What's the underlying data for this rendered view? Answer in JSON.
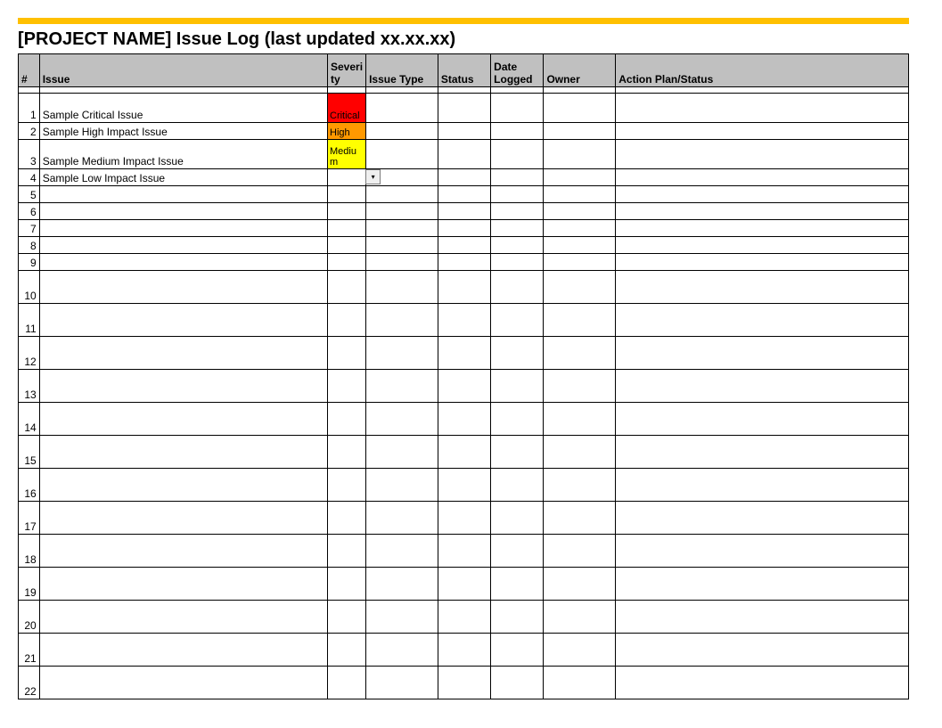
{
  "colors": {
    "accent_bar": "#ffc000",
    "header_bg": "#c0c0c0",
    "severity": {
      "critical": "#ff0000",
      "high": "#ff9900",
      "medium": "#ffff00",
      "default": "#ffffff"
    }
  },
  "title": "[PROJECT NAME] Issue Log (last updated xx.xx.xx)",
  "headers": {
    "num": "#",
    "issue": "Issue",
    "severity": "Severity",
    "issue_type": "Issue Type",
    "status": "Status",
    "date_logged": "Date Logged",
    "owner": "Owner",
    "action_plan": "Action Plan/Status"
  },
  "rows": [
    {
      "num": "1",
      "issue": "Sample Critical Issue",
      "severity": "Critical",
      "severity_key": "critical",
      "height": "med",
      "issue_type": "",
      "status": "",
      "date_logged": "",
      "owner": "",
      "action_plan": "",
      "active_dropdown": false
    },
    {
      "num": "2",
      "issue": "Sample High Impact Issue",
      "severity": "High",
      "severity_key": "high",
      "height": "short",
      "issue_type": "",
      "status": "",
      "date_logged": "",
      "owner": "",
      "action_plan": "",
      "active_dropdown": false
    },
    {
      "num": "3",
      "issue": "Sample Medium Impact Issue",
      "severity": "Medium",
      "severity_key": "medium",
      "height": "med",
      "issue_type": "",
      "status": "",
      "date_logged": "",
      "owner": "",
      "action_plan": "",
      "active_dropdown": false
    },
    {
      "num": "4",
      "issue": "Sample Low Impact Issue",
      "severity": "",
      "severity_key": "default",
      "height": "short",
      "issue_type": "",
      "status": "",
      "date_logged": "",
      "owner": "",
      "action_plan": "",
      "active_dropdown": true
    },
    {
      "num": "5",
      "issue": "",
      "severity": "",
      "severity_key": "default",
      "height": "short",
      "issue_type": "",
      "status": "",
      "date_logged": "",
      "owner": "",
      "action_plan": "",
      "active_dropdown": false
    },
    {
      "num": "6",
      "issue": "",
      "severity": "",
      "severity_key": "default",
      "height": "short",
      "issue_type": "",
      "status": "",
      "date_logged": "",
      "owner": "",
      "action_plan": "",
      "active_dropdown": false
    },
    {
      "num": "7",
      "issue": "",
      "severity": "",
      "severity_key": "default",
      "height": "short",
      "issue_type": "",
      "status": "",
      "date_logged": "",
      "owner": "",
      "action_plan": "",
      "active_dropdown": false
    },
    {
      "num": "8",
      "issue": "",
      "severity": "",
      "severity_key": "default",
      "height": "short",
      "issue_type": "",
      "status": "",
      "date_logged": "",
      "owner": "",
      "action_plan": "",
      "active_dropdown": false
    },
    {
      "num": "9",
      "issue": "",
      "severity": "",
      "severity_key": "default",
      "height": "short",
      "issue_type": "",
      "status": "",
      "date_logged": "",
      "owner": "",
      "action_plan": "",
      "active_dropdown": false
    },
    {
      "num": "10",
      "issue": "",
      "severity": "",
      "severity_key": "default",
      "height": "tall",
      "issue_type": "",
      "status": "",
      "date_logged": "",
      "owner": "",
      "action_plan": "",
      "active_dropdown": false
    },
    {
      "num": "11",
      "issue": "",
      "severity": "",
      "severity_key": "default",
      "height": "tall",
      "issue_type": "",
      "status": "",
      "date_logged": "",
      "owner": "",
      "action_plan": "",
      "active_dropdown": false
    },
    {
      "num": "12",
      "issue": "",
      "severity": "",
      "severity_key": "default",
      "height": "tall",
      "issue_type": "",
      "status": "",
      "date_logged": "",
      "owner": "",
      "action_plan": "",
      "active_dropdown": false
    },
    {
      "num": "13",
      "issue": "",
      "severity": "",
      "severity_key": "default",
      "height": "tall",
      "issue_type": "",
      "status": "",
      "date_logged": "",
      "owner": "",
      "action_plan": "",
      "active_dropdown": false
    },
    {
      "num": "14",
      "issue": "",
      "severity": "",
      "severity_key": "default",
      "height": "tall",
      "issue_type": "",
      "status": "",
      "date_logged": "",
      "owner": "",
      "action_plan": "",
      "active_dropdown": false
    },
    {
      "num": "15",
      "issue": "",
      "severity": "",
      "severity_key": "default",
      "height": "tall",
      "issue_type": "",
      "status": "",
      "date_logged": "",
      "owner": "",
      "action_plan": "",
      "active_dropdown": false
    },
    {
      "num": "16",
      "issue": "",
      "severity": "",
      "severity_key": "default",
      "height": "tall",
      "issue_type": "",
      "status": "",
      "date_logged": "",
      "owner": "",
      "action_plan": "",
      "active_dropdown": false
    },
    {
      "num": "17",
      "issue": "",
      "severity": "",
      "severity_key": "default",
      "height": "tall",
      "issue_type": "",
      "status": "",
      "date_logged": "",
      "owner": "",
      "action_plan": "",
      "active_dropdown": false
    },
    {
      "num": "18",
      "issue": "",
      "severity": "",
      "severity_key": "default",
      "height": "tall",
      "issue_type": "",
      "status": "",
      "date_logged": "",
      "owner": "",
      "action_plan": "",
      "active_dropdown": false
    },
    {
      "num": "19",
      "issue": "",
      "severity": "",
      "severity_key": "default",
      "height": "tall",
      "issue_type": "",
      "status": "",
      "date_logged": "",
      "owner": "",
      "action_plan": "",
      "active_dropdown": false
    },
    {
      "num": "20",
      "issue": "",
      "severity": "",
      "severity_key": "default",
      "height": "tall",
      "issue_type": "",
      "status": "",
      "date_logged": "",
      "owner": "",
      "action_plan": "",
      "active_dropdown": false
    },
    {
      "num": "21",
      "issue": "",
      "severity": "",
      "severity_key": "default",
      "height": "tall",
      "issue_type": "",
      "status": "",
      "date_logged": "",
      "owner": "",
      "action_plan": "",
      "active_dropdown": false
    },
    {
      "num": "22",
      "issue": "",
      "severity": "",
      "severity_key": "default",
      "height": "tall",
      "issue_type": "",
      "status": "",
      "date_logged": "",
      "owner": "",
      "action_plan": "",
      "active_dropdown": false
    }
  ]
}
